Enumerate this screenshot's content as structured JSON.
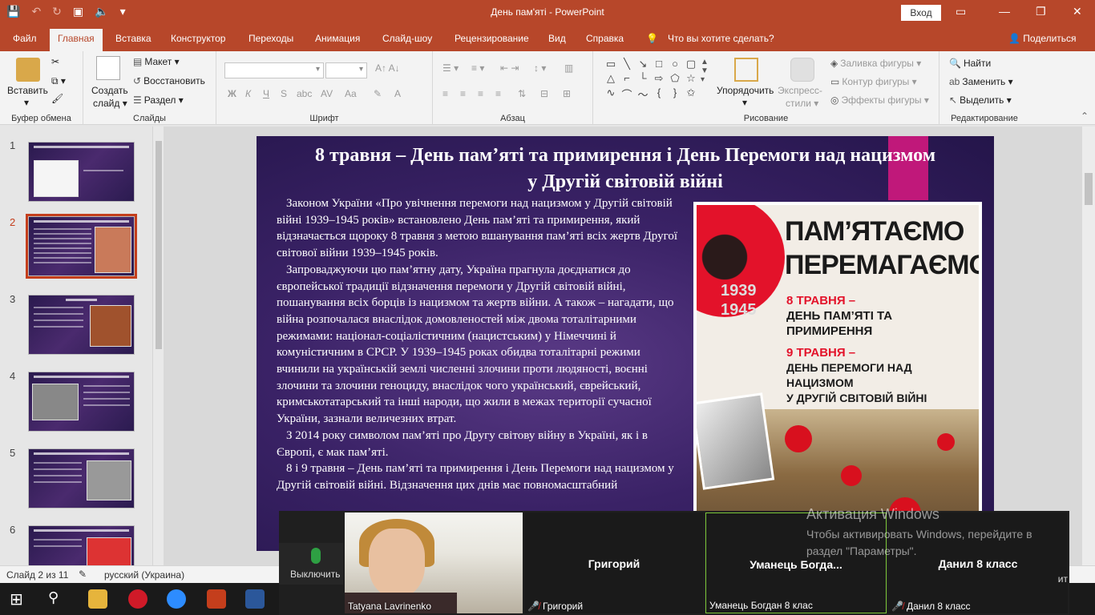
{
  "app": {
    "title": "День пам'яті  -  PowerPoint",
    "signin": "Вход"
  },
  "tabs": {
    "items": [
      "Файл",
      "Главная",
      "Вставка",
      "Конструктор",
      "Переходы",
      "Анимация",
      "Слайд-шоу",
      "Рецензирование",
      "Вид",
      "Справка"
    ],
    "tell_me": "Что вы хотите сделать?",
    "share": "Поделиться"
  },
  "ribbon": {
    "paste": "Вставить",
    "clipboard": "Буфер обмена",
    "new_slide_1": "Создать",
    "new_slide_2": "слайд",
    "layout": "Макет",
    "reset": "Восстановить",
    "section": "Раздел",
    "slides": "Слайды",
    "font": "Шрифт",
    "paragraph": "Абзац",
    "arrange": "Упорядочить",
    "express_1": "Экспресс-",
    "express_2": "стили",
    "fill": "Заливка фигуры",
    "outline": "Контур фигуры",
    "effects": "Эффекты фигуры",
    "drawing": "Рисование",
    "find": "Найти",
    "replace": "Заменить",
    "select": "Выделить",
    "editing": "Редактирование"
  },
  "thumbs": {
    "numbers": [
      "1",
      "2",
      "3",
      "4",
      "5",
      "6"
    ]
  },
  "slide": {
    "title_line1": "8  травня – День пам’яті та примирення і День Перемоги над нацизмом",
    "title_line2": "у Другій світовій війні",
    "p1": "Законом України «Про увічнення перемоги над нацизмом у Другій світовій війні 1939–1945 років» встановлено День пам’яті та примирення, який відзначається щороку 8 травня з метою вшанування пам’яті всіх жертв Другої світової війни 1939–1945 років.",
    "p2": "Запроваджуючи цю пам’ятну дату, Україна прагнула доєднатися до європейської традиції відзначення перемоги у Другій світовій війні, пошанування всіх борців із нацизмом та жертв війни. А також – нагадати, що війна розпочалася внаслідок домовленостей між двома тоталітарними режимами: націонал-соціалістичним (нацистським) у Німеччині й комуністичним в СРСР.  У 1939–1945 роках обидва тоталітарні режими вчинили на українській землі численні злочини проти людяності, воєнні злочини та злочини геноциду, внаслідок чого український, єврейський, кримськотатарський та інші народи, що жили в межах території сучасної України, зазнали величезних втрат.",
    "p3": "З 2014 року символом пам’яті про Другу світову війну в Україні, як і в Європі, є мак пам’яті.",
    "p4": "8 і 9 травня – День пам’яті та примирення і День Перемоги над нацизмом у Другій світовій війні. Відзначення цих днів має повномасштабний",
    "poster": {
      "years_top": "1939",
      "years_bottom": "1945",
      "headline_1": "ПАМ’ЯТАЄМО",
      "headline_2": "ПЕРЕМАГАЄМО",
      "d1_red": "8 ТРАВНЯ –",
      "d1_black": "ДЕНЬ ПАМ’ЯТІ ТА ПРИМИРЕННЯ",
      "d2_red": "9 ТРАВНЯ –",
      "d2_black_1": "ДЕНЬ ПЕРЕМОГИ НАД НАЦИЗМОМ",
      "d2_black_2": "У ДРУГІЙ СВІТОВІЙ ВІЙНІ"
    }
  },
  "status": {
    "slide_info": "Слайд 2 из 11",
    "language": "русский (Украина)"
  },
  "zoom": {
    "mute_label": "Выключить",
    "self_name": "Tatyana Lavrinenko",
    "tiles": [
      {
        "title": "Григорий",
        "label": "Григорий"
      },
      {
        "title": "Уманець  Богда...",
        "label": "Уманець Богдан 8 клас"
      },
      {
        "title": "Данил 8 класс",
        "label": "Данил 8 класс"
      }
    ],
    "partial": "ит"
  },
  "activation": {
    "title": "Активация Windows",
    "body": "Чтобы активировать Windows, перейдите в раздел \"Параметры\"."
  }
}
